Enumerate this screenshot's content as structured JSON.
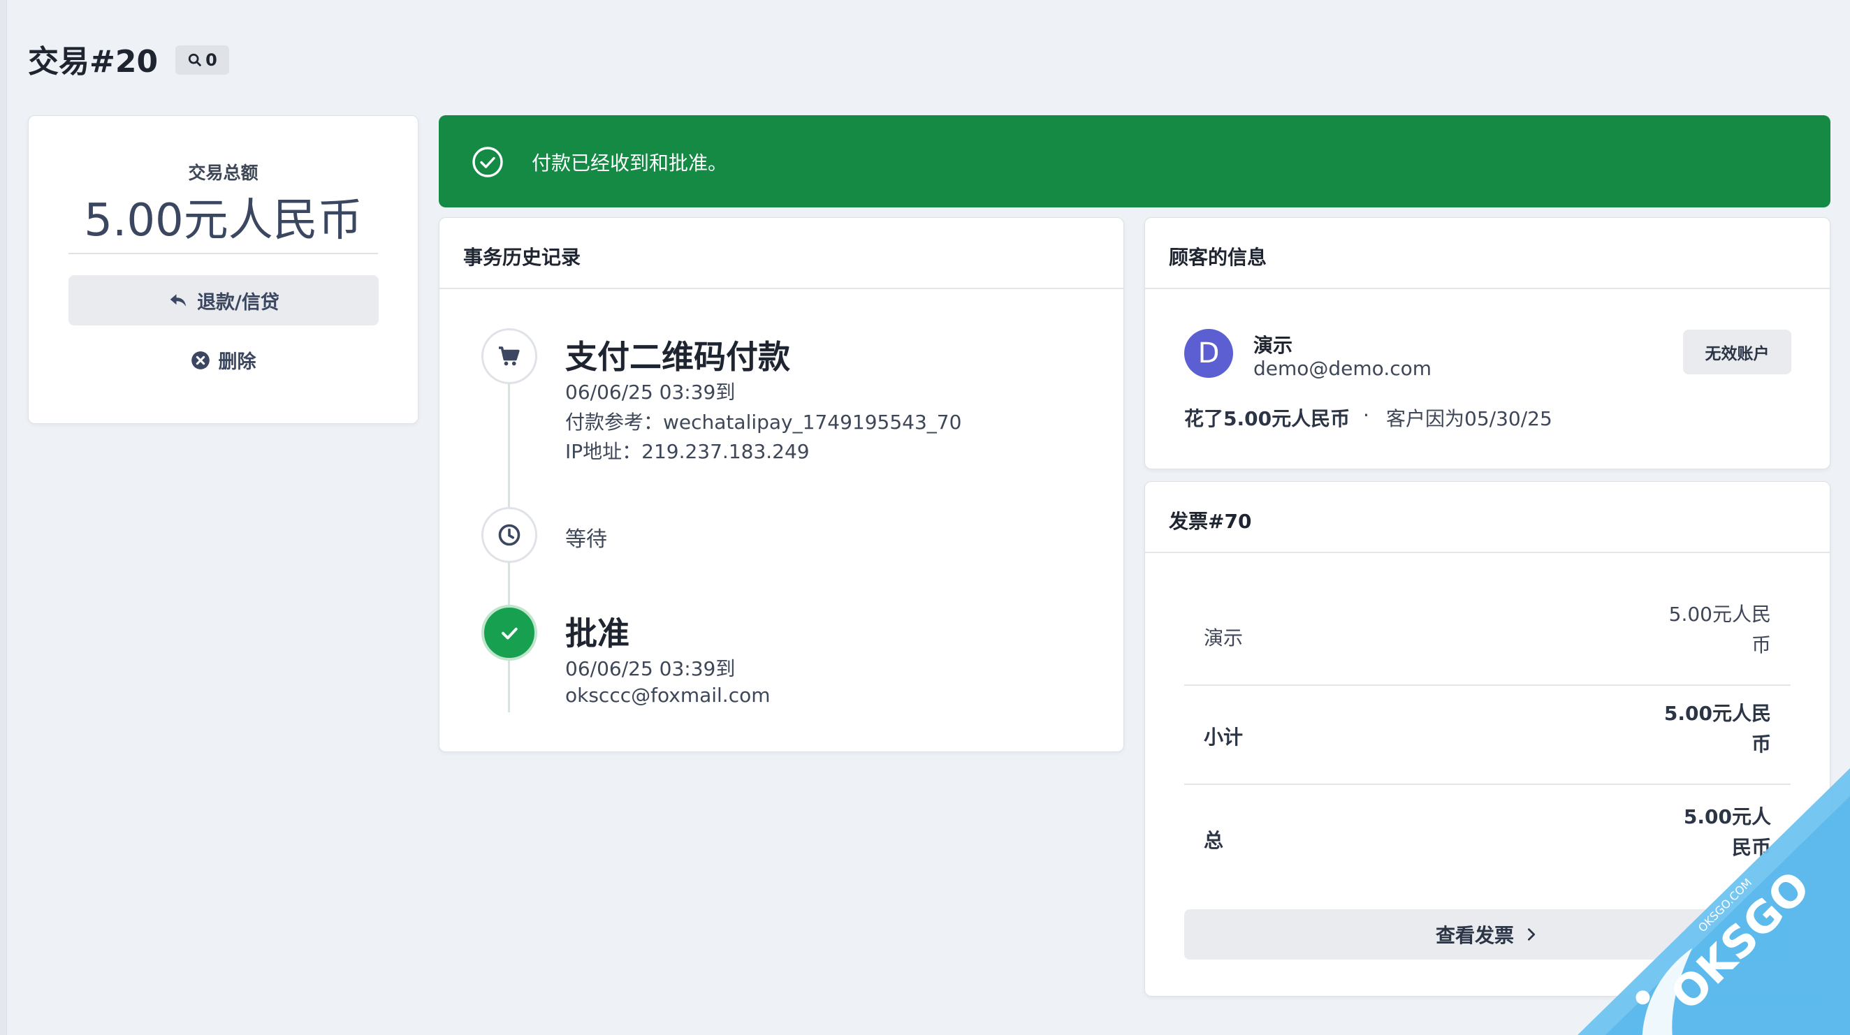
{
  "header": {
    "title": "交易#20",
    "view_count": "0"
  },
  "summary": {
    "label": "交易总额",
    "amount": "5.00元人民币",
    "refund_label": "退款/信贷",
    "delete_label": "删除"
  },
  "banner": {
    "message": "付款已经收到和批准。",
    "color": "#148a45"
  },
  "history": {
    "title": "事务历史记录",
    "events": [
      {
        "icon": "cart-icon",
        "title": "支付二维码付款",
        "date": "06/06/25 03:39到",
        "reference": "付款参考：wechatalipay_1749195543_70",
        "ip": "IP地址：219.237.183.249"
      },
      {
        "icon": "clock-icon",
        "title": "等待"
      },
      {
        "icon": "check-icon",
        "title": "批准",
        "date": "06/06/25 03:39到",
        "email": "oksccc@foxmail.com"
      }
    ]
  },
  "customer": {
    "title": "顾客的信息",
    "avatar_letter": "D",
    "avatar_color": "#5b5fd1",
    "name": "演示",
    "email": "demo@demo.com",
    "invalid_label": "无效账户",
    "spent": "花了5.00元人民币",
    "separator": "·",
    "since": "客户因为05/30/25"
  },
  "invoice": {
    "title": "发票#70",
    "rows": [
      {
        "label": "演示",
        "value_line1": "5.00元人民",
        "value_line2": "币"
      },
      {
        "label": "小计",
        "value_line1": "5.00元人民",
        "value_line2": "币"
      },
      {
        "label": "总",
        "value_line1": "5.00元人",
        "value_line2": "民币"
      }
    ],
    "view_label": "查看发票"
  },
  "watermark": {
    "text": "OKSGO",
    "subtext": "OKSGO.COM"
  }
}
